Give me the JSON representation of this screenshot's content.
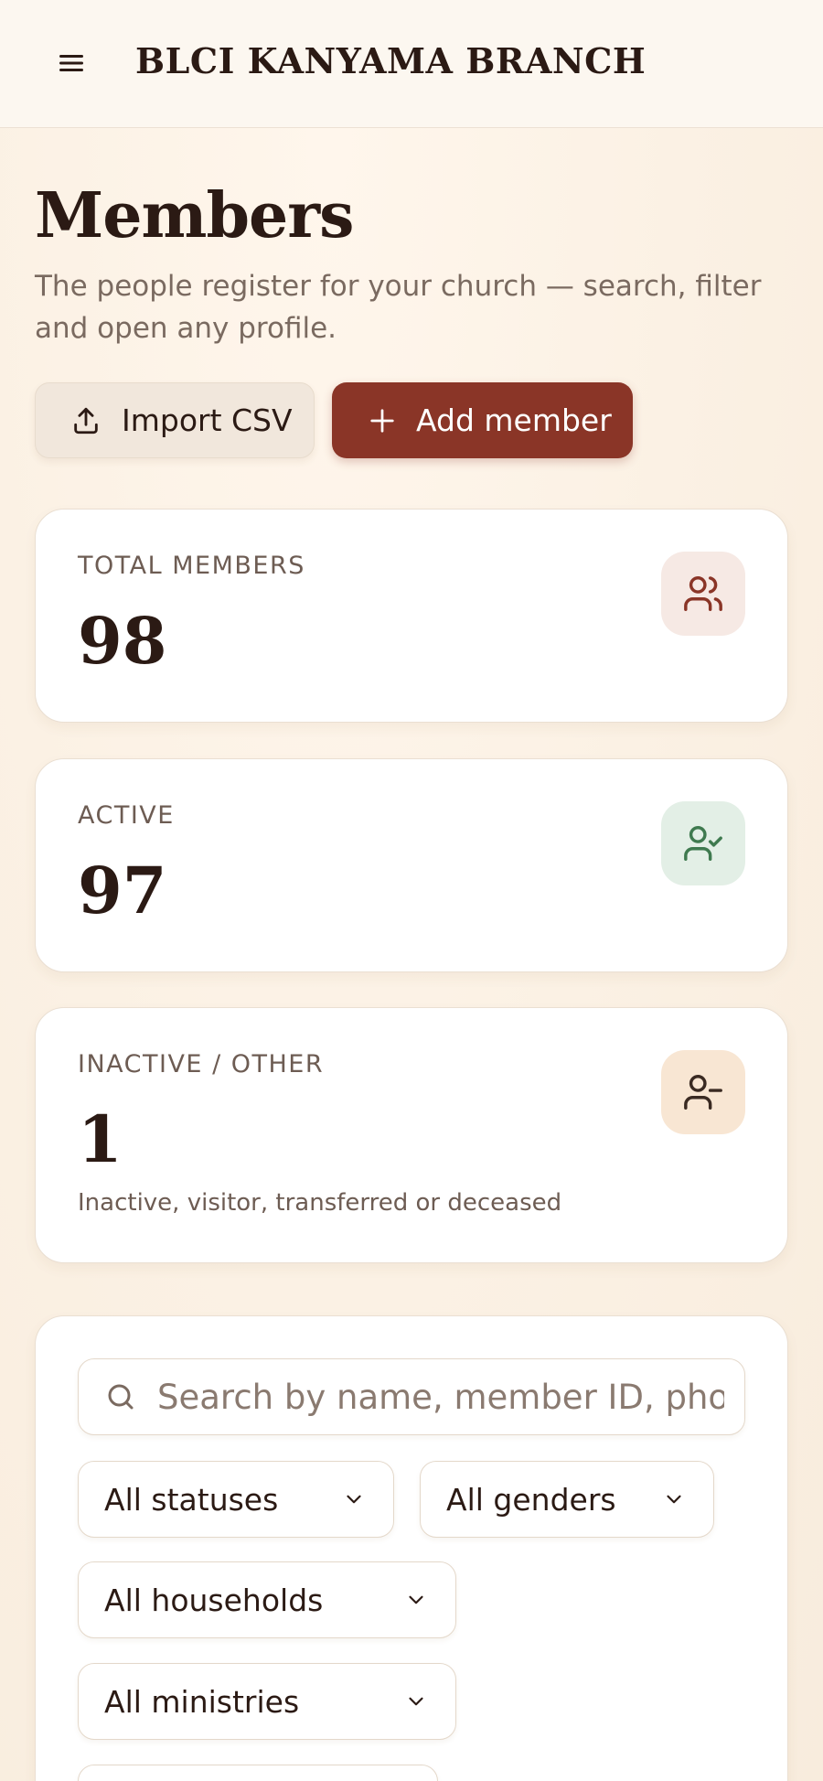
{
  "app": {
    "title": "BLCI KANYAMA BRANCH"
  },
  "page": {
    "title": "Members",
    "subtitle": "The people register for your church — search, filter and open any profile."
  },
  "actions": {
    "import_label": "Import CSV",
    "add_label": "Add member"
  },
  "stats": [
    {
      "label": "TOTAL MEMBERS",
      "value": "98",
      "icon": "users-icon",
      "icon_bg": "#f6e9e4",
      "icon_color": "#8a3527"
    },
    {
      "label": "ACTIVE",
      "value": "97",
      "icon": "user-check-icon",
      "icon_bg": "#e3efe6",
      "icon_color": "#3f7a4f"
    },
    {
      "label": "INACTIVE / OTHER",
      "value": "1",
      "note": "Inactive, visitor, transferred or deceased",
      "icon": "user-minus-icon",
      "icon_bg": "#f8e6d3",
      "icon_color": "#3a2a22"
    }
  ],
  "filters": {
    "search_placeholder": "Search by name, member ID, phone",
    "status": "All statuses",
    "gender": "All genders",
    "household": "All households",
    "ministry": "All ministries"
  },
  "colors": {
    "accent": "#8a3527",
    "background": "#fbf3e9"
  }
}
